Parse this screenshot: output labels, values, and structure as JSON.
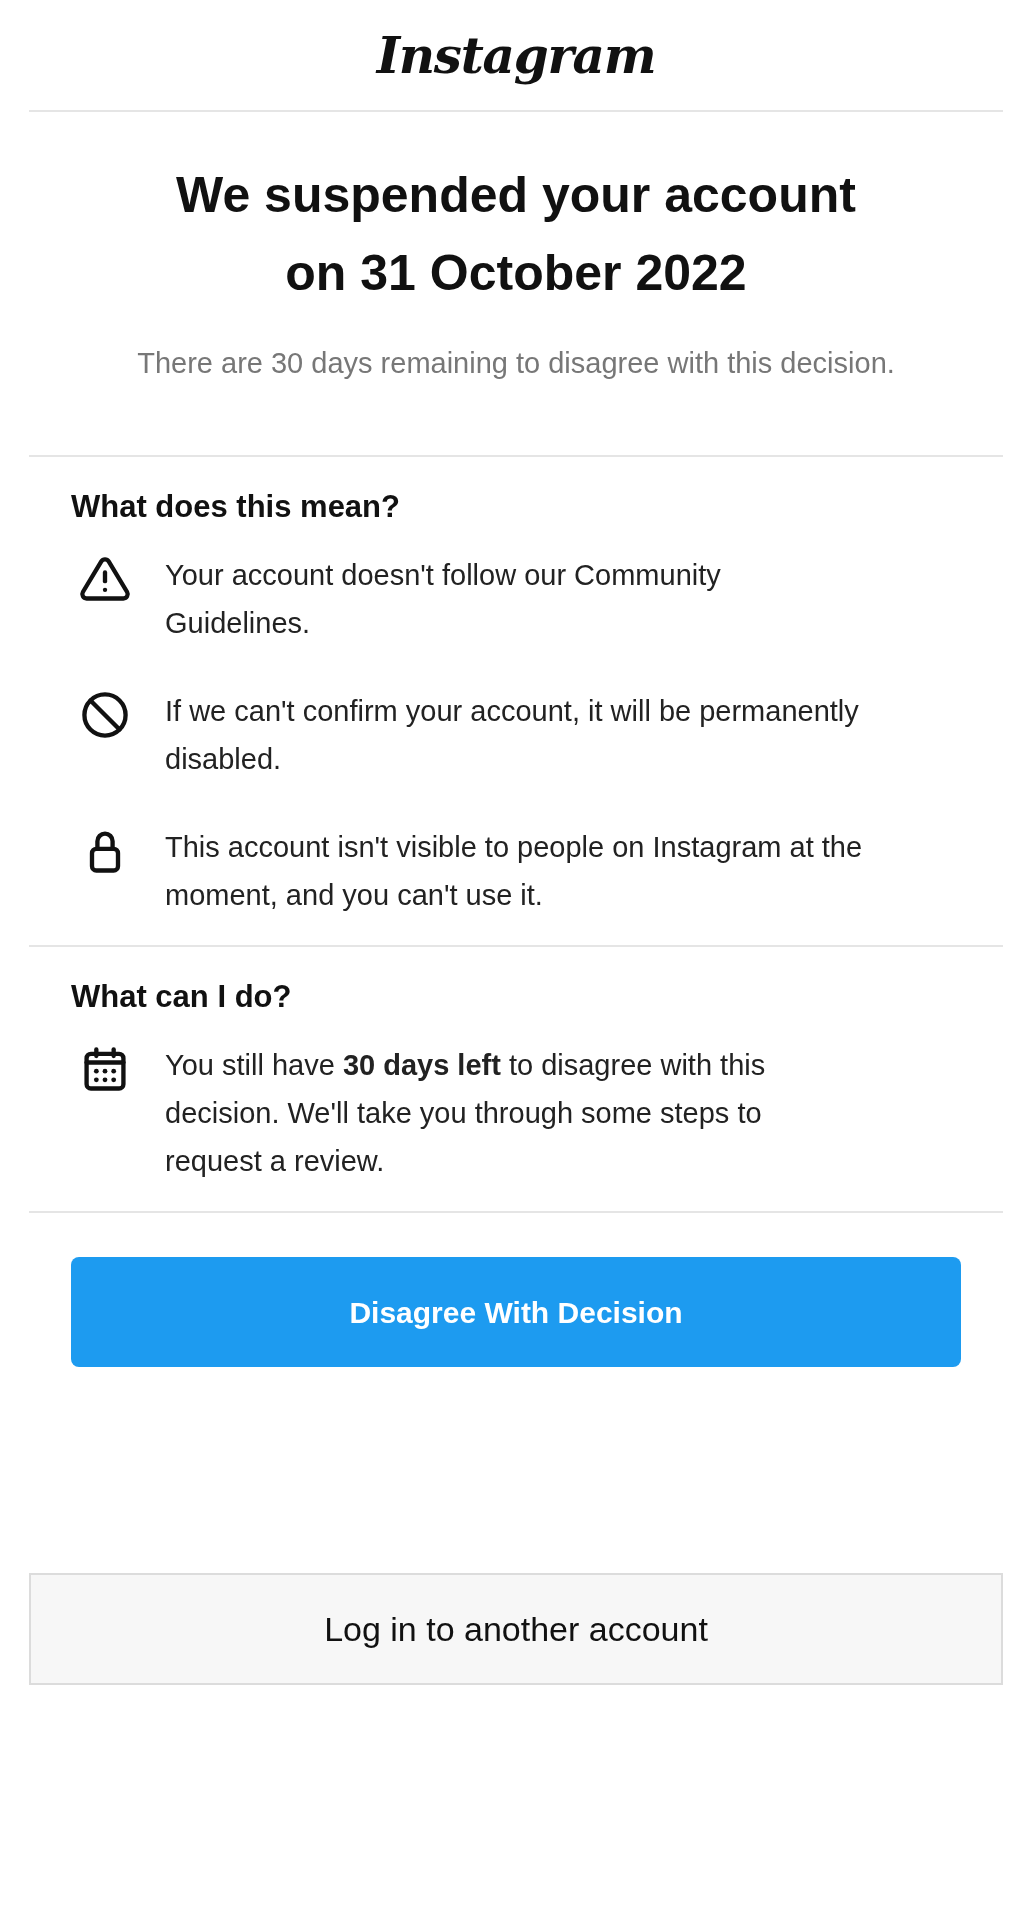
{
  "header": {
    "logo": "Instagram"
  },
  "title": [
    "We suspended your account",
    "on 31 October 2022"
  ],
  "subtitle": "There are 30 days remaining to disagree with this decision.",
  "sections": [
    {
      "heading": "What does this mean?",
      "items": [
        {
          "kind": "warning",
          "text": "Your account doesn't follow our Community Guidelines."
        },
        {
          "kind": "blocked",
          "text": "If we can't confirm your account, it will be permanently disabled."
        },
        {
          "kind": "lock",
          "text": "This account isn't visible to people on Instagram at the moment, and you can't use it."
        }
      ]
    },
    {
      "heading": "What can I do?",
      "items": [
        {
          "kind": "calendar",
          "text": "You still have **30 days left** to disagree with this decision. We'll take you through some steps to request a review."
        }
      ]
    }
  ],
  "primary_button": "Disagree With Decision",
  "secondary_button": "Log in to another account"
}
